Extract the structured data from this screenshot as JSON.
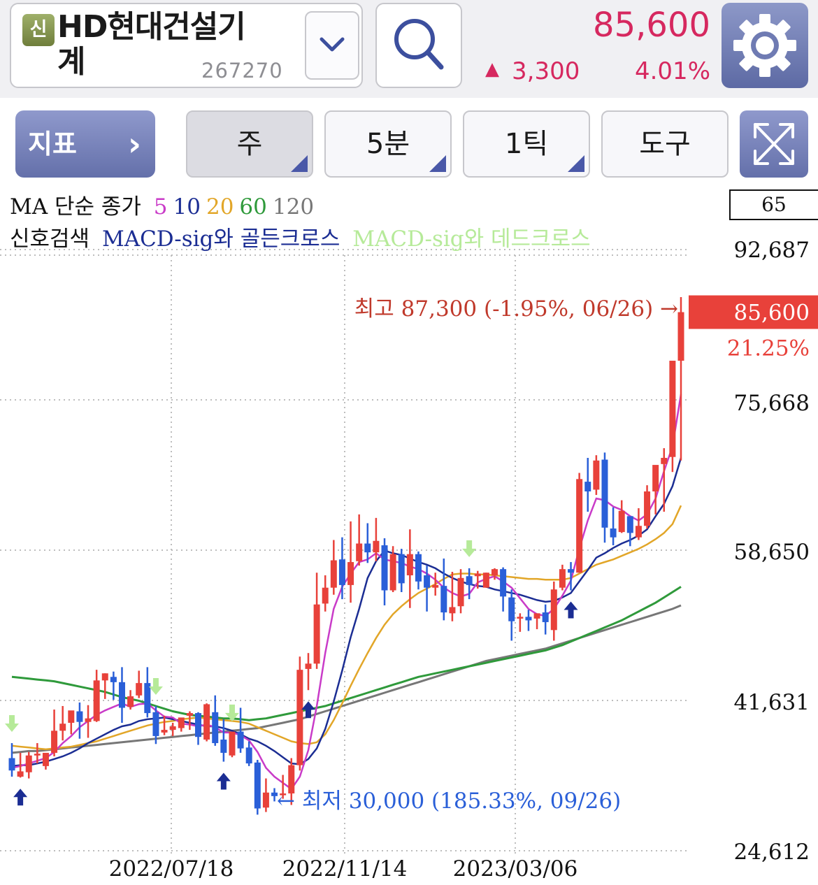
{
  "header": {
    "badge": "신",
    "stock_name_line1": "HD현대건설기",
    "stock_name_line2": "계",
    "stock_code": "267270",
    "price": "85,600",
    "change_arrow": "▲",
    "change": "3,300",
    "change_pct": "4.01%"
  },
  "toolbar": {
    "indicator_label": "지표",
    "period_label": "주",
    "minute_label": "5분",
    "tick_label": "1틱",
    "tools_label": "도구"
  },
  "legend": {
    "ma_prefix": "MA 단순 종가",
    "ma_periods": [
      {
        "label": "5",
        "color": "#c93bc8"
      },
      {
        "label": "10",
        "color": "#1b2d93"
      },
      {
        "label": "20",
        "color": "#e2a628"
      },
      {
        "label": "60",
        "color": "#2f9a3b"
      },
      {
        "label": "120",
        "color": "#777777"
      }
    ],
    "signal_prefix": "신호검색",
    "golden_cross": "MACD-sig와 골든크로스",
    "dead_cross": "MACD-sig와 데드크로스",
    "golden_color": "#1b2d93",
    "dead_color": "#b6ea99"
  },
  "chart_data": {
    "type": "candlestick",
    "visible_count": "65",
    "y_ticks": [
      "92,687",
      "75,668",
      "58,650",
      "41,631",
      "24,612"
    ],
    "y_tick_values": [
      92687,
      75668,
      58650,
      41631,
      24612
    ],
    "x_ticks": [
      "2022/07/18",
      "2022/11/14",
      "2023/03/06"
    ],
    "current_price_label": "85,600",
    "current_price": 85600,
    "current_pct_label": "21.25%",
    "high_annotation": "최고 87,300 (-1.95%, 06/26) →",
    "low_annotation": "← 최저 30,000 (185.33%, 09/26)",
    "up_color": "#e8413a",
    "down_color": "#2a5fd8",
    "candles": [
      [
        35100,
        36800,
        33700,
        33000
      ],
      [
        33000,
        35700,
        33600,
        32900
      ],
      [
        33500,
        35800,
        35400,
        32800
      ],
      [
        35400,
        36800,
        35600,
        34500
      ],
      [
        34200,
        34600,
        35700,
        33800
      ],
      [
        35700,
        40600,
        38200,
        35300
      ],
      [
        38200,
        41000,
        39000,
        37100
      ],
      [
        39100,
        39900,
        40500,
        37800
      ],
      [
        40400,
        41400,
        39200,
        37300
      ],
      [
        39200,
        41100,
        39600,
        37400
      ],
      [
        39300,
        45100,
        43900,
        39200
      ],
      [
        43900,
        44700,
        44700,
        41800
      ],
      [
        44300,
        44900,
        43700,
        41700
      ],
      [
        43700,
        45400,
        40800,
        39100
      ],
      [
        40900,
        42800,
        42100,
        40600
      ],
      [
        42200,
        45000,
        43600,
        41900
      ],
      [
        43600,
        45400,
        40200,
        39700
      ],
      [
        40300,
        41000,
        37600,
        36700
      ],
      [
        38000,
        39900,
        38300,
        37700
      ],
      [
        38300,
        39100,
        38700,
        37600
      ],
      [
        38500,
        39300,
        39700,
        38100
      ],
      [
        39900,
        40400,
        40200,
        38300
      ],
      [
        40200,
        40300,
        37500,
        36600
      ],
      [
        37200,
        41300,
        41200,
        37000
      ],
      [
        40300,
        42200,
        36800,
        36500
      ],
      [
        37200,
        39500,
        35700,
        34700
      ],
      [
        35400,
        38000,
        38100,
        35200
      ],
      [
        38100,
        40800,
        36200,
        35700
      ],
      [
        36300,
        37000,
        34500,
        34200
      ],
      [
        34600,
        34900,
        29400,
        28700
      ],
      [
        29500,
        32800,
        31200,
        29000
      ],
      [
        31200,
        31700,
        30800,
        30200
      ],
      [
        30900,
        33200,
        31100,
        30500
      ],
      [
        31100,
        35100,
        34300,
        29800
      ],
      [
        34300,
        46600,
        45100,
        33700
      ],
      [
        45200,
        47000,
        45800,
        42800
      ],
      [
        45800,
        56100,
        52500,
        45200
      ],
      [
        52600,
        55800,
        54400,
        51700
      ],
      [
        54400,
        59800,
        57500,
        53600
      ],
      [
        57600,
        60100,
        54700,
        53100
      ],
      [
        54700,
        61900,
        57300,
        52700
      ],
      [
        57400,
        62700,
        59400,
        56900
      ],
      [
        59400,
        61700,
        58400,
        57200
      ],
      [
        58400,
        62300,
        59700,
        57400
      ],
      [
        59200,
        60000,
        54100,
        52400
      ],
      [
        54100,
        59100,
        58200,
        53900
      ],
      [
        58200,
        58800,
        54900,
        53900
      ],
      [
        55800,
        61000,
        58200,
        52100
      ],
      [
        58200,
        58500,
        55100,
        54200
      ],
      [
        55800,
        56900,
        54400,
        51700
      ],
      [
        54400,
        56100,
        54700,
        53500
      ],
      [
        54600,
        57700,
        51600,
        50700
      ],
      [
        51500,
        56200,
        52200,
        50600
      ],
      [
        52300,
        56500,
        55500,
        51500
      ],
      [
        55700,
        56600,
        54700,
        53100
      ],
      [
        55700,
        56300,
        56000,
        54300
      ],
      [
        54400,
        56100,
        56100,
        54400
      ],
      [
        55800,
        56600,
        56500,
        55300
      ],
      [
        56500,
        56700,
        53400,
        51700
      ],
      [
        53300,
        54200,
        50600,
        48400
      ],
      [
        50900,
        51500,
        51100,
        49400
      ],
      [
        51100,
        51900,
        50700,
        49500
      ],
      [
        50900,
        51200,
        51500,
        49700
      ],
      [
        51600,
        52500,
        50500,
        49100
      ],
      [
        49600,
        55100,
        54200,
        48400
      ],
      [
        54400,
        57000,
        56500,
        54100
      ],
      [
        56500,
        57300,
        56100,
        54100
      ],
      [
        56100,
        67400,
        66700,
        56100
      ],
      [
        66400,
        69100,
        65300,
        63000
      ],
      [
        65500,
        69400,
        68800,
        64900
      ],
      [
        68900,
        69700,
        61200,
        59500
      ],
      [
        61100,
        63500,
        60100,
        59200
      ],
      [
        60700,
        64300,
        63100,
        60600
      ],
      [
        62500,
        61500,
        60600,
        59100
      ],
      [
        60100,
        63400,
        61400,
        59800
      ],
      [
        61400,
        66000,
        65300,
        61100
      ],
      [
        65300,
        68000,
        68300,
        62700
      ],
      [
        68400,
        70200,
        69100,
        63000
      ],
      [
        69200,
        71700,
        80100,
        67500
      ],
      [
        80100,
        87300,
        85600,
        68800
      ]
    ],
    "series": [
      {
        "name": "5",
        "values": [
          34000,
          34200,
          34500,
          34800,
          35100,
          35800,
          36800,
          37600,
          38600,
          39300,
          40000,
          40500,
          40900,
          41300,
          40900,
          41200,
          41300,
          40500,
          39800,
          39700,
          39000,
          38900,
          38700,
          38900,
          38600,
          38000,
          38000,
          37700,
          37100,
          35800,
          34000,
          33000,
          32300,
          31600,
          33000,
          36000,
          41000,
          47000,
          52000,
          54500,
          56000,
          57300,
          57600,
          58300,
          57600,
          57400,
          57200,
          56800,
          56500,
          56000,
          55300,
          54400,
          53800,
          53400,
          53700,
          55000,
          55400,
          55700,
          55100,
          54400,
          53200,
          52000,
          51400,
          51200,
          52000,
          53500,
          55200,
          58800,
          62000,
          64500,
          64300,
          63600,
          63200,
          62500,
          62000,
          62700,
          64500,
          67600,
          70400,
          76300
        ]
      },
      {
        "name": "10",
        "values": [
          34200,
          34300,
          34300,
          34500,
          34700,
          35000,
          35300,
          35700,
          36200,
          36800,
          37300,
          37800,
          38300,
          38700,
          38900,
          39300,
          39500,
          39600,
          39700,
          39500,
          39300,
          39100,
          38900,
          38700,
          38700,
          38500,
          38200,
          37800,
          37300,
          37000,
          36500,
          35900,
          35200,
          34500,
          34400,
          35000,
          36200,
          38400,
          41500,
          45000,
          48800,
          52000,
          55500,
          57400,
          58600,
          58300,
          58100,
          57700,
          57300,
          57000,
          56600,
          56000,
          55500,
          55100,
          54800,
          54600,
          54500,
          54200,
          54000,
          53800,
          53600,
          53300,
          53000,
          52800,
          52900,
          53300,
          53800,
          55100,
          56400,
          57800,
          58300,
          58900,
          59400,
          59800,
          60300,
          61000,
          62500,
          63900,
          65900,
          69100
        ]
      },
      {
        "name": "20",
        "values": [
          36500,
          36400,
          36300,
          36200,
          36100,
          36200,
          36300,
          36400,
          36600,
          36800,
          37000,
          37300,
          37600,
          37900,
          38200,
          38500,
          38800,
          39000,
          39200,
          39300,
          39500,
          39600,
          39700,
          39600,
          39500,
          39400,
          39300,
          39200,
          39000,
          38600,
          38200,
          37800,
          37400,
          37000,
          36800,
          36700,
          36900,
          37800,
          39400,
          41300,
          43300,
          45200,
          47000,
          48700,
          50200,
          51400,
          52300,
          53100,
          53800,
          54300,
          54800,
          55400,
          55900,
          56000,
          56000,
          55900,
          55900,
          55800,
          55700,
          55600,
          55500,
          55400,
          55400,
          55300,
          55300,
          55300,
          55500,
          56000,
          56500,
          57000,
          57300,
          57600,
          58000,
          58400,
          58800,
          59300,
          59900,
          60600,
          61600,
          63700
        ]
      },
      {
        "name": "60",
        "values": [
          44300,
          44200,
          44100,
          44000,
          43900,
          43800,
          43600,
          43400,
          43200,
          43000,
          42800,
          42600,
          42300,
          42000,
          41800,
          41600,
          41300,
          41000,
          40700,
          40400,
          40200,
          40000,
          39900,
          39800,
          39700,
          39600,
          39600,
          39500,
          39400,
          39500,
          39600,
          39800,
          40000,
          40200,
          40400,
          40600,
          40800,
          41000,
          41300,
          41600,
          41900,
          42200,
          42500,
          42800,
          43100,
          43400,
          43700,
          44000,
          44300,
          44500,
          44700,
          44900,
          45100,
          45300,
          45500,
          45700,
          45900,
          46100,
          46300,
          46500,
          46700,
          46900,
          47100,
          47300,
          47600,
          47900,
          48300,
          48700,
          49100,
          49500,
          49900,
          50300,
          50700,
          51200,
          51700,
          52200,
          52700,
          53300,
          53900,
          54500
        ]
      },
      {
        "name": "120",
        "values": [
          35700,
          35800,
          35900,
          35900,
          36000,
          36100,
          36200,
          36300,
          36400,
          36500,
          36600,
          36700,
          36800,
          36900,
          37000,
          37100,
          37200,
          37300,
          37400,
          37500,
          37600,
          37700,
          37800,
          37900,
          38000,
          38100,
          38200,
          38300,
          38400,
          38500,
          38700,
          38900,
          39100,
          39300,
          39500,
          39800,
          40100,
          40400,
          40700,
          41000,
          41300,
          41600,
          41900,
          42200,
          42500,
          42800,
          43100,
          43400,
          43700,
          44000,
          44300,
          44600,
          44900,
          45200,
          45500,
          45800,
          46100,
          46300,
          46500,
          46700,
          46900,
          47100,
          47300,
          47500,
          47800,
          48100,
          48400,
          48700,
          49000,
          49300,
          49600,
          49900,
          50200,
          50500,
          50800,
          51100,
          51400,
          51700,
          52000,
          52400
        ]
      }
    ],
    "golden_cross_idx": [
      1,
      25,
      35,
      66
    ],
    "dead_cross_idx": [
      0,
      17,
      26,
      54
    ]
  }
}
